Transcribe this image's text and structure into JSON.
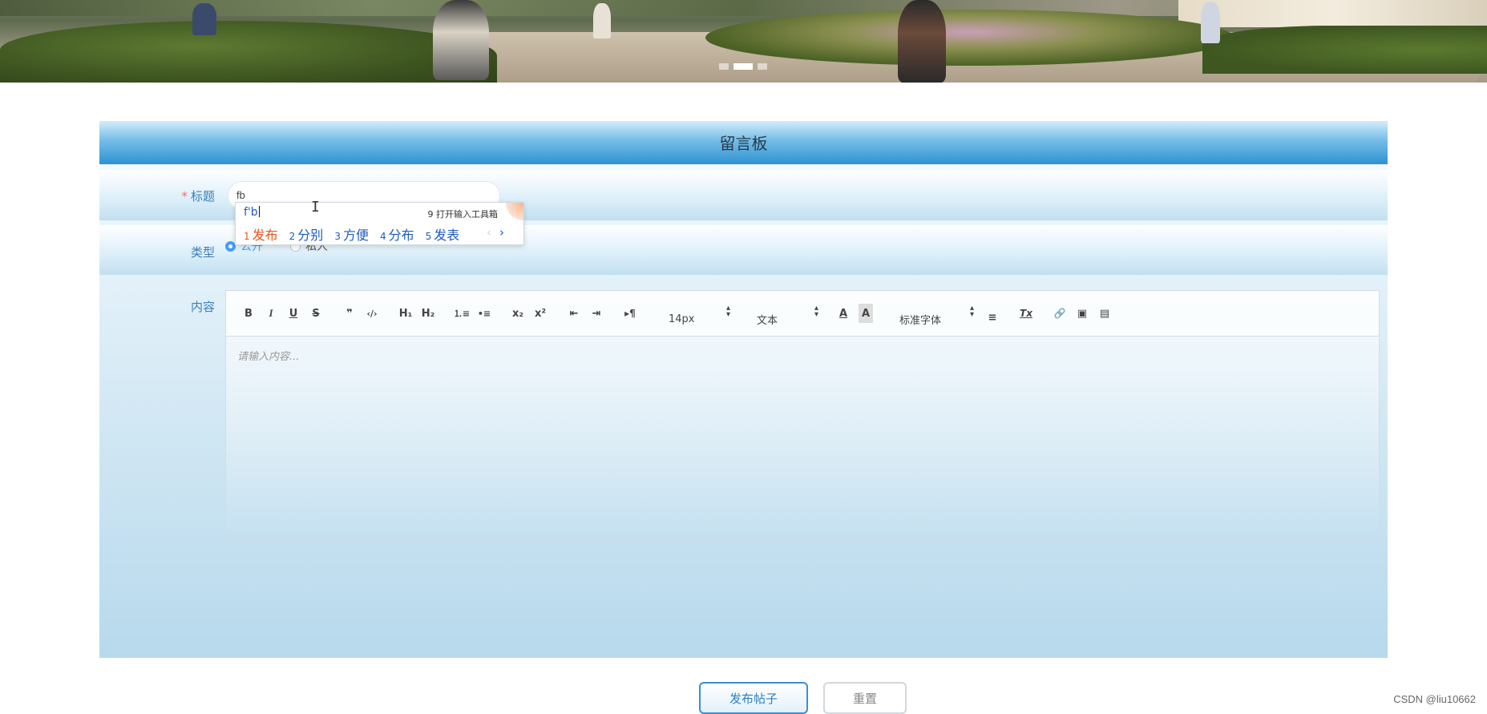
{
  "panel": {
    "title": "留言板"
  },
  "form": {
    "title_label": "标题",
    "required_mark": "*",
    "title_value": "fb",
    "type_label": "类型",
    "type_options": [
      {
        "label": "公开",
        "checked": true
      },
      {
        "label": "私人",
        "checked": false
      }
    ],
    "content_label": "内容"
  },
  "editor": {
    "toolbar": {
      "bold": "B",
      "italic": "I",
      "underline": "U",
      "strike": "S",
      "blockquote": "❞",
      "code_block": "‹/›",
      "h1": "H₁",
      "h2": "H₂",
      "ordered_list": "⒈≡",
      "bullet_list": "•≡",
      "subscript": "x₂",
      "superscript": "x²",
      "outdent": "⇤",
      "indent": "⇥",
      "direction": "▸¶",
      "size_value": "14px",
      "header_value": "文本",
      "font_value": "标准字体",
      "text_color": "A",
      "background_color": "A",
      "align": "≡",
      "clean": "Tx",
      "link": "🔗",
      "image": "▣",
      "video": "▤"
    },
    "placeholder": "请输入内容..."
  },
  "ime": {
    "pinyin": "f'b",
    "tool_label": "9 打开输入工具箱",
    "candidates": [
      {
        "num": "1",
        "word": "发布"
      },
      {
        "num": "2",
        "word": "分别"
      },
      {
        "num": "3",
        "word": "方便"
      },
      {
        "num": "4",
        "word": "分布"
      },
      {
        "num": "5",
        "word": "发表"
      }
    ],
    "next": "›",
    "prev": "‹"
  },
  "buttons": {
    "submit": "发布帖子",
    "reset": "重置"
  },
  "watermark": "CSDN @liu10662",
  "colors": {
    "header_blue": "#2f92d2",
    "label_blue": "#3a7fb8",
    "radio_blue": "#409eff",
    "ime_highlight": "#e8561d"
  }
}
